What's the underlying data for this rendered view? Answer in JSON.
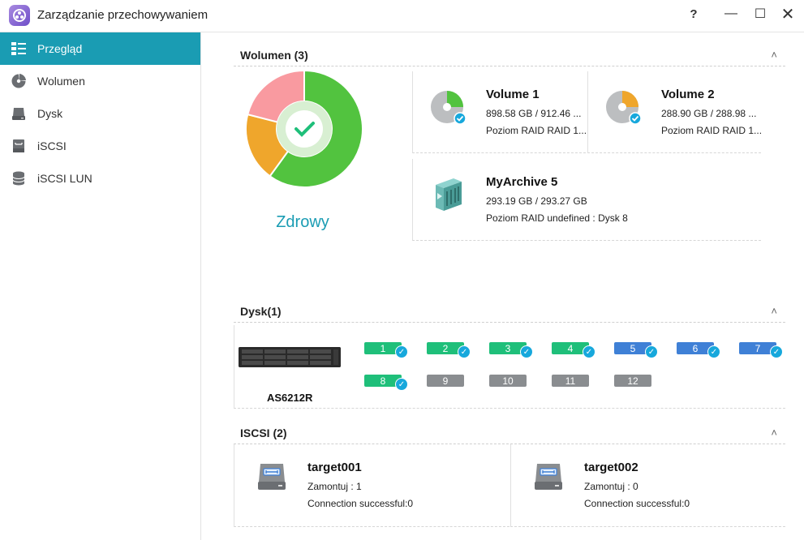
{
  "window": {
    "title": "Zarządzanie przechowywaniem",
    "help_glyph": "?",
    "min_glyph": "—",
    "max_glyph": "☐",
    "close_glyph": "✕"
  },
  "sidebar": {
    "items": [
      {
        "label": "Przegląd",
        "icon": "overview-icon",
        "active": true
      },
      {
        "label": "Wolumen",
        "icon": "volume-icon",
        "active": false
      },
      {
        "label": "Dysk",
        "icon": "disk-icon",
        "active": false
      },
      {
        "label": "iSCSI",
        "icon": "iscsi-icon",
        "active": false
      },
      {
        "label": "iSCSI LUN",
        "icon": "iscsi-lun-icon",
        "active": false
      }
    ]
  },
  "volume_section": {
    "title": "Wolumen (3)",
    "chevron": "˄",
    "health_status": "Zdrowy",
    "donut_segments": [
      {
        "label": "green",
        "value": 60,
        "color": "#52c33f"
      },
      {
        "label": "orange",
        "value": 19,
        "color": "#efa62c"
      },
      {
        "label": "pink",
        "value": 21,
        "color": "#f99aa0"
      }
    ],
    "volumes": [
      {
        "name": "Volume 1",
        "usage": "898.58 GB / 912.46 ...",
        "raid": "Poziom RAID RAID 1...",
        "accent": "#52c33f"
      },
      {
        "name": "Volume 2",
        "usage": "288.90 GB / 288.98 ...",
        "raid": "Poziom RAID RAID 1...",
        "accent": "#efa62c"
      },
      {
        "name": "MyArchive 5",
        "usage": "293.19 GB / 293.27 GB",
        "raid": "Poziom RAID undefined : Dysk 8",
        "accent": "#5bbfb5"
      }
    ]
  },
  "disk_section": {
    "title": "Dysk(1)",
    "chevron": "˄",
    "nas_name": "AS6212R",
    "slots": [
      {
        "num": "1",
        "state": "green",
        "check": true
      },
      {
        "num": "2",
        "state": "green",
        "check": true
      },
      {
        "num": "3",
        "state": "green",
        "check": true
      },
      {
        "num": "4",
        "state": "green",
        "check": true
      },
      {
        "num": "5",
        "state": "blue",
        "check": true
      },
      {
        "num": "6",
        "state": "blue",
        "check": true
      },
      {
        "num": "7",
        "state": "blue",
        "check": true
      },
      {
        "num": "8",
        "state": "green",
        "check": true
      },
      {
        "num": "9",
        "state": "gray",
        "check": false
      },
      {
        "num": "10",
        "state": "gray",
        "check": false
      },
      {
        "num": "11",
        "state": "gray",
        "check": false
      },
      {
        "num": "12",
        "state": "gray",
        "check": false
      }
    ]
  },
  "iscsi_section": {
    "title": "ISCSI (2)",
    "chevron": "˄",
    "targets": [
      {
        "name": "target001",
        "mount": "Zamontuj : 1",
        "connection": "Connection successful:0"
      },
      {
        "name": "target002",
        "mount": "Zamontuj : 0",
        "connection": "Connection successful:0"
      }
    ]
  },
  "colors": {
    "accent": "#1a9cb3",
    "check_badge": "#17a8dc"
  }
}
